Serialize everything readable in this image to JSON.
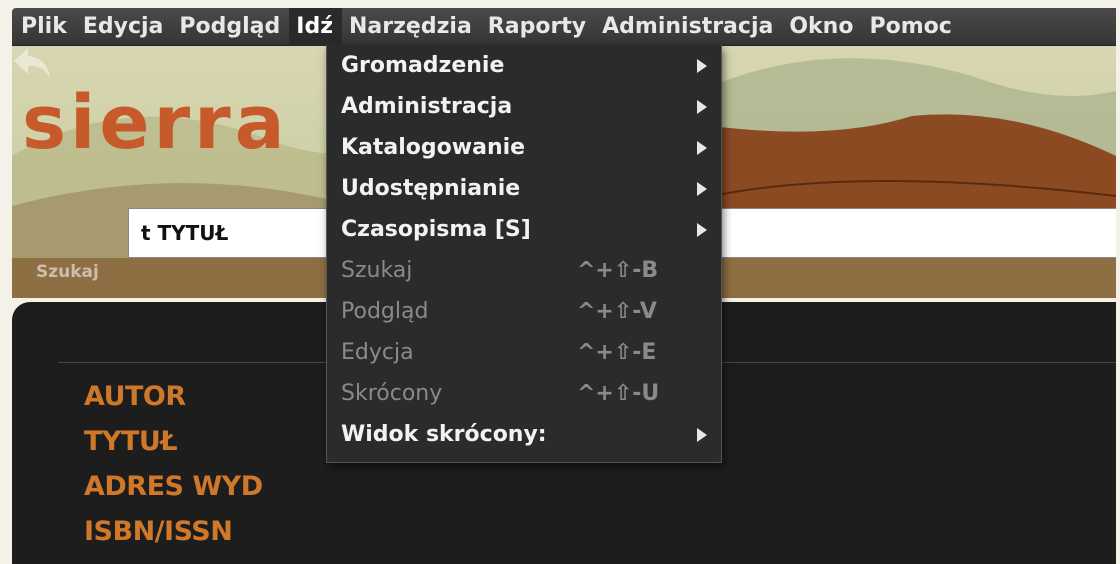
{
  "menubar": {
    "items": [
      {
        "label": "Plik"
      },
      {
        "label": "Edycja"
      },
      {
        "label": "Podgląd"
      },
      {
        "label": "Idź"
      },
      {
        "label": "Narzędzia"
      },
      {
        "label": "Raporty"
      },
      {
        "label": "Administracja"
      },
      {
        "label": "Okno"
      },
      {
        "label": "Pomoc"
      }
    ],
    "active": "Idź"
  },
  "banner": {
    "logo": "sierra",
    "search_value": "t TYTUŁ",
    "search_label": "Szukaj"
  },
  "dropdown": {
    "items": [
      {
        "label": "Gromadzenie",
        "submenu": true,
        "enabled": true
      },
      {
        "label": "Administracja",
        "submenu": true,
        "enabled": true
      },
      {
        "label": "Katalogowanie",
        "submenu": true,
        "enabled": true
      },
      {
        "label": "Udostępnianie",
        "submenu": true,
        "enabled": true
      },
      {
        "label": "Czasopisma [S]",
        "submenu": true,
        "enabled": true
      },
      {
        "label": "Szukaj",
        "shortcut": "^+⇧-B",
        "enabled": false
      },
      {
        "label": "Podgląd",
        "shortcut": "^+⇧-V",
        "enabled": false
      },
      {
        "label": "Edycja",
        "shortcut": "^+⇧-E",
        "enabled": false
      },
      {
        "label": "Skrócony",
        "shortcut": "^+⇧-U",
        "enabled": false
      },
      {
        "label": "Widok skrócony:",
        "submenu": true,
        "enabled": true
      }
    ]
  },
  "panel": {
    "fields": [
      "AUTOR",
      "TYTUŁ",
      "ADRES WYD",
      "ISBN/ISSN"
    ]
  },
  "colors": {
    "logo": "#c65a2a",
    "field_labels": "#d0782a",
    "menubar": "#3f3f3f",
    "dropdown_bg": "#2b2b2b"
  }
}
